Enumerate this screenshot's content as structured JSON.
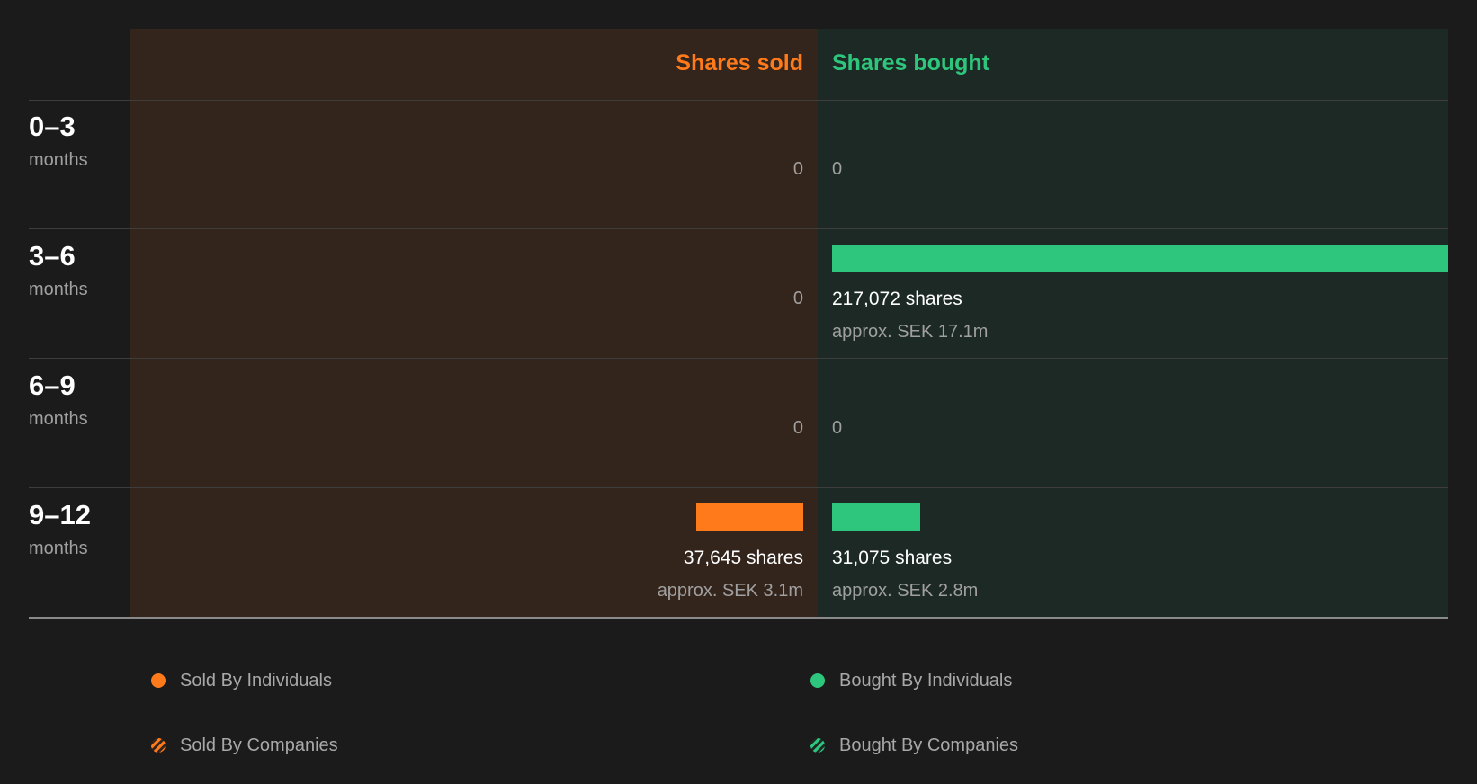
{
  "colors": {
    "sold": "#ff7a1a",
    "bought": "#2ec57c",
    "sold_panel": "#33241c",
    "bought_panel": "#1c2925",
    "background": "#1b1b1b"
  },
  "headers": {
    "sold": "Shares sold",
    "bought": "Shares bought"
  },
  "rows": [
    {
      "range": "0–3",
      "unit": "months",
      "sold": {
        "zero_label": "0"
      },
      "bought": {
        "zero_label": "0"
      }
    },
    {
      "range": "3–6",
      "unit": "months",
      "sold": {
        "zero_label": "0"
      },
      "bought": {
        "shares_label": "217,072 shares",
        "value_label": "approx. SEK 17.1m"
      }
    },
    {
      "range": "6–9",
      "unit": "months",
      "sold": {
        "zero_label": "0"
      },
      "bought": {
        "zero_label": "0"
      }
    },
    {
      "range": "9–12",
      "unit": "months",
      "sold": {
        "shares_label": "37,645 shares",
        "value_label": "approx. SEK 3.1m"
      },
      "bought": {
        "shares_label": "31,075 shares",
        "value_label": "approx. SEK 2.8m"
      }
    }
  ],
  "legend": {
    "sold_individuals": "Sold By Individuals",
    "bought_individuals": "Bought By Individuals",
    "sold_companies": "Sold By Companies",
    "bought_companies": "Bought By Companies"
  },
  "chart_data": {
    "type": "bar",
    "orientation": "horizontal-diverging",
    "categories": [
      "0–3 months",
      "3–6 months",
      "6–9 months",
      "9–12 months"
    ],
    "series": [
      {
        "name": "Shares sold",
        "values": [
          0,
          0,
          0,
          37645
        ],
        "sek_millions": [
          0,
          0,
          0,
          3.1
        ]
      },
      {
        "name": "Shares bought",
        "values": [
          0,
          217072,
          0,
          31075
        ],
        "sek_millions": [
          0,
          17.1,
          0,
          2.8
        ]
      }
    ],
    "xlim": [
      0,
      217072
    ],
    "grid": false,
    "legend_placement": "bottom"
  }
}
